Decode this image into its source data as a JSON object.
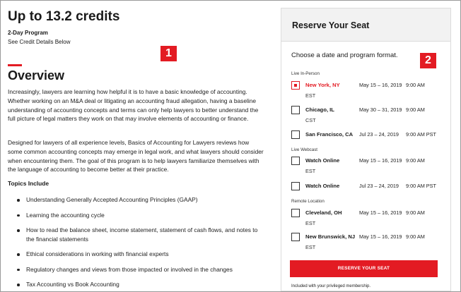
{
  "program": {
    "credits_title": "Up to 13.2 credits",
    "duration": "2-Day Program",
    "credit_details": "See Credit Details Below",
    "badge_left": "1",
    "badge_right": "2"
  },
  "overview": {
    "title": "Overview",
    "paragraph_1": "Increasingly, lawyers are learning how helpful it is to have a basic knowledge of accounting. Whether working on an M&A deal or litigating an accounting fraud allegation, having a baseline understanding of accounting concepts and terms can only help lawyers to better understand the full picture of legal matters they work on that may involve elements of accounting or finance.",
    "paragraph_2": "Designed for lawyers of all experience levels, Basics of Accounting for Lawyers reviews how some common accounting concepts may emerge in legal work, and what lawyers should consider when encountering them. The goal of this program is to help lawyers familiarize themselves with the language of accounting to become better at their practice.",
    "topics_heading": "Topics Include",
    "topics": [
      "Understanding Generally Accepted Accounting Principles (GAAP)",
      "Learning the accounting cycle",
      "How to read the balance sheet, income statement, statement of cash flows, and notes to the financial statements",
      "Ethical considerations in working with financial experts",
      "Regulatory changes and views from those impacted or involved in the changes",
      "Tax Accounting vs Book Accounting"
    ]
  },
  "reserve": {
    "title": "Reserve Your Seat",
    "choose_text": "Choose a date and program format.",
    "groups": {
      "in_person": "Live In-Person",
      "webcast": "Live Webcast",
      "remote": "Remote Location"
    },
    "sessions": [
      {
        "city": "New York, NY",
        "tz": "EST",
        "dates": "May 15 – 16, 2019",
        "time": "9:00 AM",
        "selected": true
      },
      {
        "city": "Chicago, IL",
        "tz": "CST",
        "dates": "May 30 – 31, 2019",
        "time": "9:00 AM",
        "selected": false
      },
      {
        "city": "San Francisco, CA",
        "tz": "",
        "dates": "Jul 23 – 24, 2019",
        "time": "9:00 AM PST",
        "selected": false
      },
      {
        "city": "Watch Online",
        "tz": "EST",
        "dates": "May 15 – 16, 2019",
        "time": "9:00 AM",
        "selected": false
      },
      {
        "city": "Watch Online",
        "tz": "",
        "dates": "Jul 23 – 24, 2019",
        "time": "9:00 AM PST",
        "selected": false
      },
      {
        "city": "Cleveland, OH",
        "tz": "EST",
        "dates": "May 15 – 16, 2019",
        "time": "9:00 AM",
        "selected": false
      },
      {
        "city": "New Brunswick, NJ",
        "tz": "EST",
        "dates": "May 15 – 16, 2019",
        "time": "9:00 AM",
        "selected": false
      }
    ],
    "button_label": "RESERVE YOUR SEAT",
    "membership_note": "Included with your privileged membership."
  },
  "colors": {
    "accent": "#e31b23",
    "header_bg": "#f2f2f2"
  }
}
